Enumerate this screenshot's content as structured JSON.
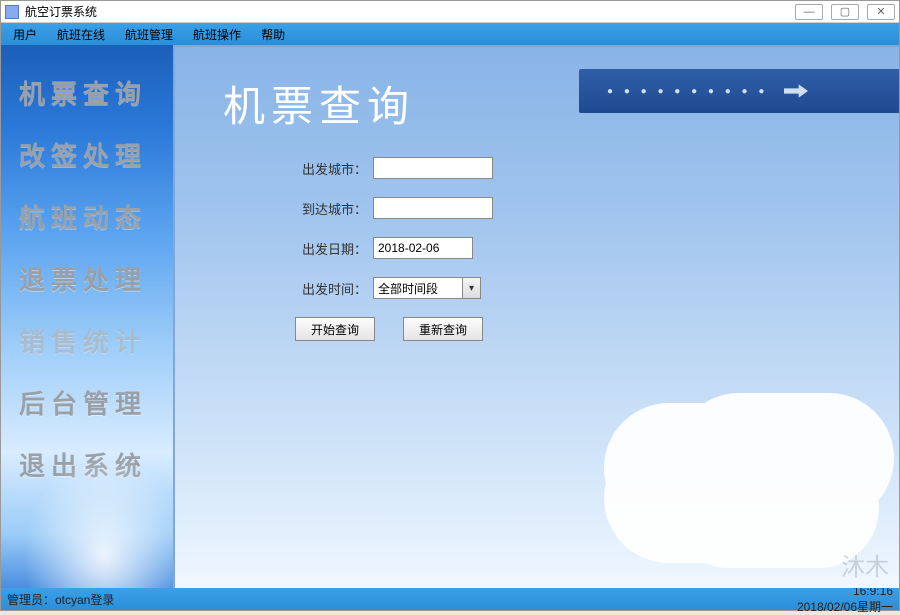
{
  "window": {
    "title": "航空订票系统"
  },
  "menubar": {
    "items": [
      "用户",
      "航班在线",
      "航班管理",
      "航班操作",
      "帮助"
    ]
  },
  "sidebar": {
    "items": [
      "机票查询",
      "改签处理",
      "航班动态",
      "退票处理",
      "销售统计",
      "后台管理",
      "退出系统"
    ]
  },
  "banner": {
    "dots": "● ● ● ● ● ● ● ● ● ●"
  },
  "page": {
    "title": "机票查询"
  },
  "form": {
    "departure_city_label": "出发城市：",
    "departure_city_value": "",
    "arrival_city_label": "到达城市：",
    "arrival_city_value": "",
    "departure_date_label": "出发日期：",
    "departure_date_value": "2018-02-06",
    "departure_time_label": "出发时间：",
    "departure_time_value": "全部时间段",
    "search_button": "开始查询",
    "reset_button": "重新查询"
  },
  "statusbar": {
    "left": "管理员：otcyan登录",
    "right_time": "16:9:16",
    "right_date": "2018/02/06星期一"
  },
  "watermark": "沐木"
}
